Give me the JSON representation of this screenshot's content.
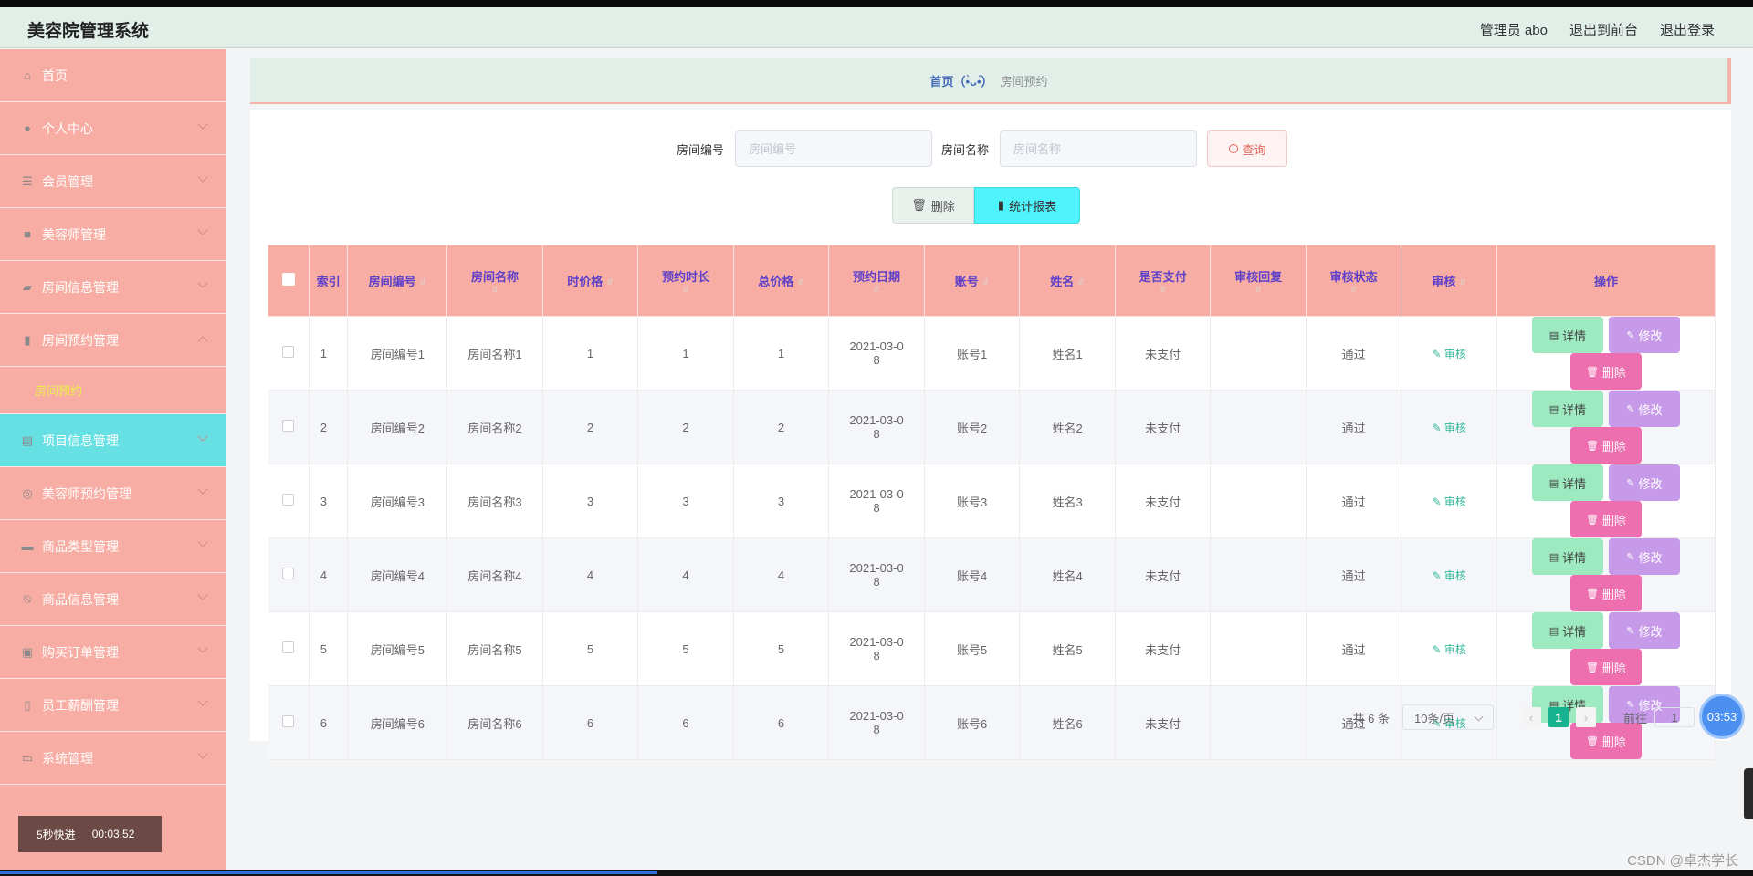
{
  "app": {
    "title": "美容院管理系统"
  },
  "header": {
    "admin": "管理员 abo",
    "front": "退出到前台",
    "logout": "退出登录"
  },
  "sidebar": {
    "items": [
      {
        "label": "首页",
        "icon": "home-icon"
      },
      {
        "label": "个人中心",
        "icon": "user-icon"
      },
      {
        "label": "会员管理",
        "icon": "list-icon"
      },
      {
        "label": "美容师管理",
        "icon": "briefcase-icon"
      },
      {
        "label": "房间信息管理",
        "icon": "truck-icon"
      },
      {
        "label": "房间预约管理",
        "icon": "chart-icon",
        "submenu": "房间预约"
      },
      {
        "label": "项目信息管理",
        "icon": "document-icon"
      },
      {
        "label": "美容师预约管理",
        "icon": "lifebuoy-icon"
      },
      {
        "label": "商品类型管理",
        "icon": "monitor-icon"
      },
      {
        "label": "商品信息管理",
        "icon": "bell-off-icon"
      },
      {
        "label": "购买订单管理",
        "icon": "box-icon"
      },
      {
        "label": "员工薪酬管理",
        "icon": "microphone-icon"
      },
      {
        "label": "系统管理",
        "icon": "card-icon"
      }
    ]
  },
  "speed": {
    "label": "5秒快进",
    "time": "00:03:52"
  },
  "breadcrumb": {
    "home": "首页（•̀ᴗ•́）",
    "current": "房间预约"
  },
  "search": {
    "room_no_label": "房间编号",
    "room_no_placeholder": "房间编号",
    "room_name_label": "房间名称",
    "room_name_placeholder": "房间名称",
    "query": "查询"
  },
  "actions": {
    "delete": "删除",
    "stats": "统计报表"
  },
  "table": {
    "headers": [
      "索引",
      "房间编号",
      "房间名称",
      "时价格",
      "预约时长",
      "总价格",
      "预约日期",
      "账号",
      "姓名",
      "是否支付",
      "审核回复",
      "审核状态",
      "审核",
      "操作"
    ],
    "rows": [
      {
        "idx": "1",
        "no": "房间编号1",
        "name": "房间名称1",
        "price": "1",
        "dur": "1",
        "total": "1",
        "date1": "2021-03-0",
        "date2": "8",
        "acct": "账号1",
        "person": "姓名1",
        "paid": "未支付",
        "reply": "",
        "status": "通过"
      },
      {
        "idx": "2",
        "no": "房间编号2",
        "name": "房间名称2",
        "price": "2",
        "dur": "2",
        "total": "2",
        "date1": "2021-03-0",
        "date2": "8",
        "acct": "账号2",
        "person": "姓名2",
        "paid": "未支付",
        "reply": "",
        "status": "通过"
      },
      {
        "idx": "3",
        "no": "房间编号3",
        "name": "房间名称3",
        "price": "3",
        "dur": "3",
        "total": "3",
        "date1": "2021-03-0",
        "date2": "8",
        "acct": "账号3",
        "person": "姓名3",
        "paid": "未支付",
        "reply": "",
        "status": "通过"
      },
      {
        "idx": "4",
        "no": "房间编号4",
        "name": "房间名称4",
        "price": "4",
        "dur": "4",
        "total": "4",
        "date1": "2021-03-0",
        "date2": "8",
        "acct": "账号4",
        "person": "姓名4",
        "paid": "未支付",
        "reply": "",
        "status": "通过"
      },
      {
        "idx": "5",
        "no": "房间编号5",
        "name": "房间名称5",
        "price": "5",
        "dur": "5",
        "total": "5",
        "date1": "2021-03-0",
        "date2": "8",
        "acct": "账号5",
        "person": "姓名5",
        "paid": "未支付",
        "reply": "",
        "status": "通过"
      },
      {
        "idx": "6",
        "no": "房间编号6",
        "name": "房间名称6",
        "price": "6",
        "dur": "6",
        "total": "6",
        "date1": "2021-03-0",
        "date2": "8",
        "acct": "账号6",
        "person": "姓名6",
        "paid": "未支付",
        "reply": "",
        "status": "通过"
      }
    ],
    "audit_label": "审核",
    "btn_detail": "详情",
    "btn_edit": "修改",
    "btn_delete": "删除"
  },
  "pager": {
    "total": "共 6 条",
    "size": "10条/页",
    "current": "1",
    "goto": "前往",
    "goto_value": "1"
  },
  "overlay": {
    "timer": "03:53",
    "watermark": "CSDN @卓杰学长"
  },
  "colors": {
    "sidebar": "#f7ada3",
    "active": "#67e0e3",
    "header": "#e1efe8",
    "stat": "#4ff3fb",
    "pager_active": "#17b390"
  }
}
